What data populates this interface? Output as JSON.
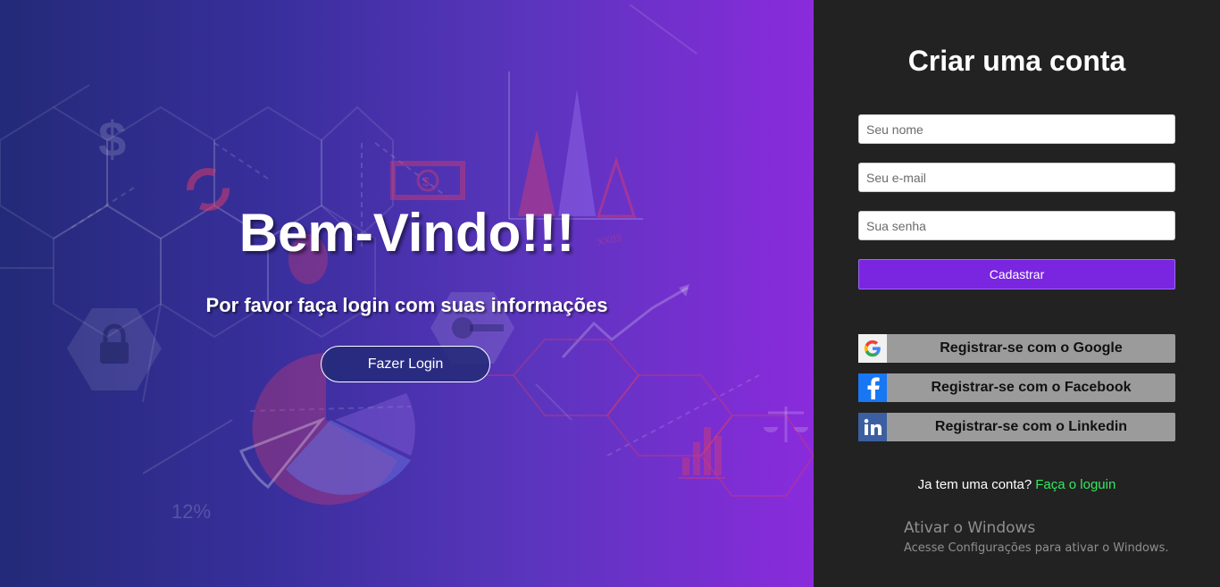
{
  "colors": {
    "hero_gradient_start": "#232a78",
    "hero_gradient_end": "#8a2bdc",
    "panel_background": "#222222",
    "submit_button": "#7a25e0",
    "social_button": "#9b9b9b",
    "link_accent": "#35e860"
  },
  "hero": {
    "title": "Bem-Vindo!!!",
    "subtitle": "Por favor faça login com suas informações",
    "login_button": "Fazer Login",
    "background_decor": {
      "percent_label": "12%",
      "code_label": "XX03"
    }
  },
  "signup": {
    "title": "Criar uma conta",
    "name_placeholder": "Seu nome",
    "email_placeholder": "Seu e-mail",
    "password_placeholder": "Sua senha",
    "submit_label": "Cadastrar",
    "social": [
      {
        "label": "Registrar-se com o Google",
        "icon": "google-icon"
      },
      {
        "label": "Registrar-se com o Facebook",
        "icon": "facebook-icon"
      },
      {
        "label": "Registrar-se com o Linkedin",
        "icon": "linkedin-icon"
      }
    ],
    "have_account_text": "Ja tem uma conta?",
    "login_link": "Faça o loguin"
  },
  "windows_watermark": {
    "title": "Ativar o Windows",
    "subtitle": "Acesse Configurações para ativar o Windows."
  }
}
